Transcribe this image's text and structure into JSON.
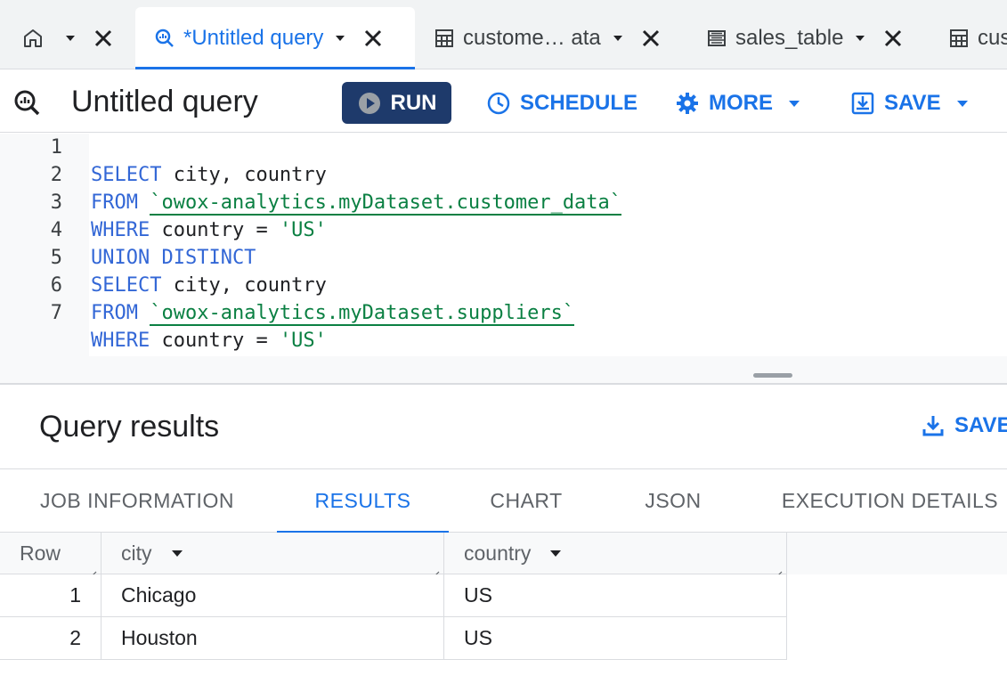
{
  "tabs": {
    "home": {
      "icon": "home-icon"
    },
    "items": [
      {
        "label": "*Untitled query",
        "icon": "query-icon",
        "active": true
      },
      {
        "label": "custome… ata",
        "icon": "table-icon",
        "active": false
      },
      {
        "label": "sales_table",
        "icon": "table-rows-icon",
        "active": false
      },
      {
        "label": "cus",
        "icon": "table-icon",
        "active": false
      }
    ]
  },
  "toolbar": {
    "title": "Untitled query",
    "run_label": "RUN",
    "schedule_label": "SCHEDULE",
    "more_label": "MORE",
    "save_label": "SAVE"
  },
  "editor": {
    "lines": [
      {
        "n": "1",
        "kw": "SELECT",
        "rest": " city, country"
      },
      {
        "n": "2",
        "kw": "FROM",
        "rest": " ",
        "table": "`owox-analytics.myDataset.customer_data`"
      },
      {
        "n": "3",
        "kw": "WHERE",
        "rest": " country = ",
        "str": "'US'"
      },
      {
        "n": "4",
        "kw": "UNION DISTINCT",
        "rest": ""
      },
      {
        "n": "5",
        "kw": "SELECT",
        "rest": " city, country"
      },
      {
        "n": "6",
        "kw": "FROM",
        "rest": " ",
        "table": "`owox-analytics.myDataset.suppliers`"
      },
      {
        "n": "7",
        "kw": "WHERE",
        "rest": " country = ",
        "str": "'US'"
      }
    ]
  },
  "results": {
    "title": "Query results",
    "save_label": "SAVE",
    "tabs": [
      "JOB INFORMATION",
      "RESULTS",
      "CHART",
      "JSON",
      "EXECUTION DETAILS"
    ],
    "active_tab": "RESULTS",
    "columns": [
      "Row",
      "city",
      "country"
    ],
    "rows": [
      [
        "1",
        "Chicago",
        "US"
      ],
      [
        "2",
        "Houston",
        "US"
      ]
    ]
  },
  "colors": {
    "accent": "#1a73e8",
    "run_button": "#1e3a6b",
    "keyword": "#3367d6",
    "string": "#0b8043"
  }
}
